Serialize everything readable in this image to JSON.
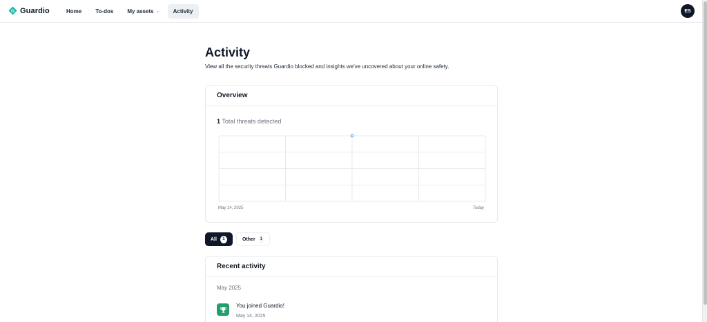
{
  "brand": {
    "name": "Guardio",
    "accent": "#14b8a6"
  },
  "nav": {
    "items": [
      {
        "label": "Home"
      },
      {
        "label": "To-dos"
      },
      {
        "label": "My assets"
      },
      {
        "label": "Activity"
      }
    ],
    "active": "Activity"
  },
  "user": {
    "initials": "ES"
  },
  "page": {
    "title": "Activity",
    "description": "View all the security threats Guardio blocked and insights we've uncovered about your online safety."
  },
  "overview": {
    "title": "Overview",
    "total_count": "1",
    "total_label": "Total threats detected",
    "chart_data": {
      "type": "line",
      "x": [
        "May 14, 2025",
        "Today"
      ],
      "series": [
        {
          "values": [
            1
          ]
        }
      ],
      "start_label": "May 14, 2025",
      "end_label": "Today",
      "grid": true
    }
  },
  "filters": [
    {
      "label": "All",
      "count": "1",
      "selected": true
    },
    {
      "label": "Other",
      "count": "1",
      "selected": false
    }
  ],
  "recent": {
    "title": "Recent activity",
    "month": "May 2025",
    "items": [
      {
        "title": "You joined Guardio!",
        "date": "May 14, 2025",
        "icon": "trophy-icon",
        "color": "#22a06b"
      }
    ]
  }
}
